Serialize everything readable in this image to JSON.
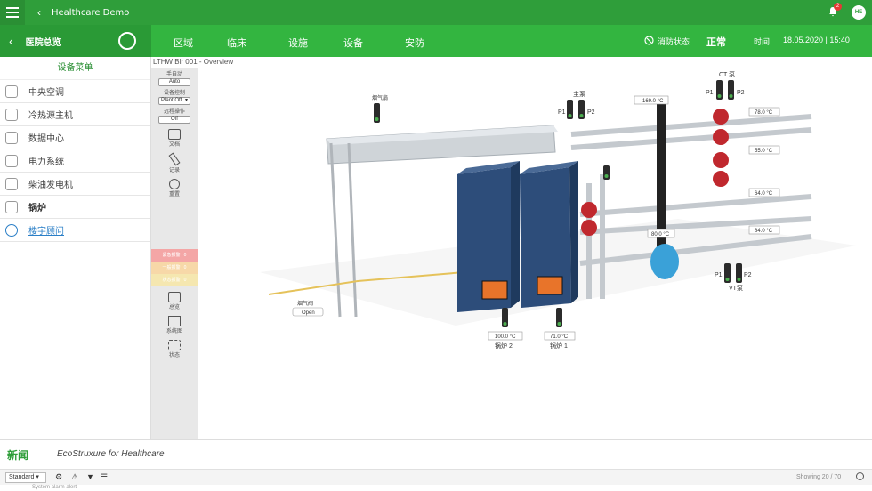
{
  "topbar": {
    "back": "‹",
    "title": "Healthcare Demo",
    "badge": "2",
    "avatar": "HE"
  },
  "nav": {
    "back": "‹",
    "title": "医院总览",
    "tabs": [
      "区域",
      "临床",
      "设施",
      "设备",
      "安防"
    ],
    "status_label": "消防状态",
    "status_value": "正常",
    "time_label": "时间",
    "datetime": "18.05.2020 | 15:40"
  },
  "sidebar": {
    "header": "设备菜单",
    "items": [
      "中央空调",
      "冷热源主机",
      "数据中心",
      "电力系统",
      "柴油发电机",
      "锅炉",
      "楼宇顾问"
    ]
  },
  "breadcrumb": "LTHW Blr 001 - Overview",
  "tools": {
    "hand_label": "手自动",
    "hand_value": "Auto",
    "control_label": "设备控制",
    "control_value": "Plant Off",
    "sched_label": "远程操作",
    "sched_value": "Off",
    "icons": [
      "文档",
      "记录",
      "重置"
    ],
    "alarm_bars": [
      "紧急报警 : 0",
      "一般报警 : 0",
      "状态报警 : 0"
    ],
    "bottom_icons": [
      "总览",
      "系统图",
      "状态"
    ]
  },
  "scada": {
    "flue_fan": "烟气扇",
    "main_pump": "主泵",
    "ct_pump": "CT 泵",
    "vt_pump": "VT泵",
    "p1": "P1",
    "p2": "P2",
    "temp_top": "169.0 °C",
    "temp_mid": "80.0 °C",
    "temps_right": [
      "78.0 °C",
      "55.0 °C",
      "64.0 °C",
      "84.0 °C"
    ],
    "boiler2_temp": "100.0 °C",
    "boiler1_temp": "71.0 °C",
    "boiler2": "锅炉 2",
    "boiler1": "锅炉 1",
    "damper": "烟气阀",
    "damper_state": "Open"
  },
  "bottom": {
    "news": "新闻",
    "brand": "EcoStruxure for Healthcare",
    "filter": "Standard",
    "showing": "Showing 20 / 70",
    "row_hint": "System alarm alert"
  },
  "colors": {
    "green": "#33b540",
    "dark_green": "#2a9a36",
    "boiler_blue": "#2d4d7a",
    "pump_red": "#c0282e"
  }
}
